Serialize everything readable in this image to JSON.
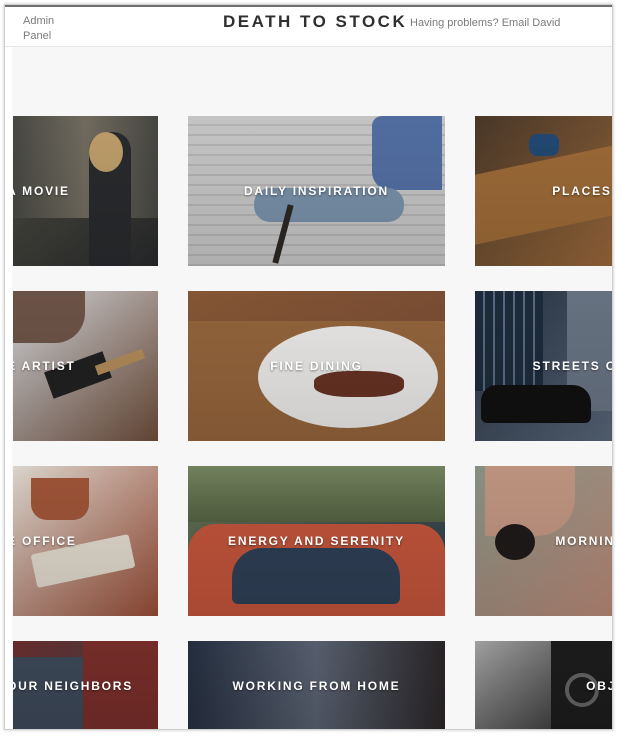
{
  "header": {
    "admin_label": "Admin Panel",
    "site_title": "DEATH TO STOCK",
    "help_text": "Having problems? Email David"
  },
  "tiles": [
    {
      "label": "A MOVIE",
      "scene": "couple-walking",
      "colors": [
        "#555448",
        "#9a8e7a",
        "#2a2b2d"
      ],
      "image_icon": "people-photo-icon"
    },
    {
      "label": "DAILY INSPIRATION",
      "scene": "woman-on-chair",
      "colors": [
        "#c4c4c3",
        "#536c9c",
        "#7890ab"
      ],
      "image_icon": "chair-photo-icon"
    },
    {
      "label": "PLACES T",
      "scene": "kitchen-counter",
      "colors": [
        "#4d3a2a",
        "#2b2f35",
        "#a16d3d"
      ],
      "image_icon": "kitchen-photo-icon"
    },
    {
      "label": "E ARTIST",
      "scene": "paintbrush",
      "colors": [
        "#dde1e5",
        "#4a596e",
        "#72503d"
      ],
      "image_icon": "brush-photo-icon"
    },
    {
      "label": "FINE DINING",
      "scene": "dinner-plate",
      "colors": [
        "#8c5b38",
        "#f4f2f0",
        "#7a4d35"
      ],
      "image_icon": "food-photo-icon"
    },
    {
      "label": "STREETS OF",
      "scene": "city-street",
      "colors": [
        "#263040",
        "#111111",
        "#5d6c7f"
      ],
      "image_icon": "street-photo-icon"
    },
    {
      "label": "E OFFICE",
      "scene": "desk-notebook",
      "colors": [
        "#e7e1d8",
        "#7f6b59",
        "#9d4f38"
      ],
      "image_icon": "office-photo-icon"
    },
    {
      "label": "ENERGY AND SERENITY",
      "scene": "van-nature",
      "colors": [
        "#6a7552",
        "#c05537",
        "#2b3b4f"
      ],
      "image_icon": "nature-photo-icon"
    },
    {
      "label": "MORNING",
      "scene": "hands-coffee",
      "colors": [
        "#8d9889",
        "#3d2f2b",
        "#c18d7b"
      ],
      "image_icon": "morning-photo-icon"
    },
    {
      "label": "OUR NEIGHBORS",
      "scene": "neighbors",
      "colors": [
        "#6c2f2d",
        "#9b7d6a",
        "#3b4452"
      ],
      "image_icon": "neighbors-photo-icon"
    },
    {
      "label": "WORKING FROM HOME",
      "scene": "laptop-work",
      "colors": [
        "#293243",
        "#5a6575",
        "#2e2b2d"
      ],
      "image_icon": "work-photo-icon"
    },
    {
      "label": "OBJE",
      "scene": "camera-objects",
      "colors": [
        "#a9a9a9",
        "#535353",
        "#1d1d1d"
      ],
      "image_icon": "camera-photo-icon"
    }
  ]
}
